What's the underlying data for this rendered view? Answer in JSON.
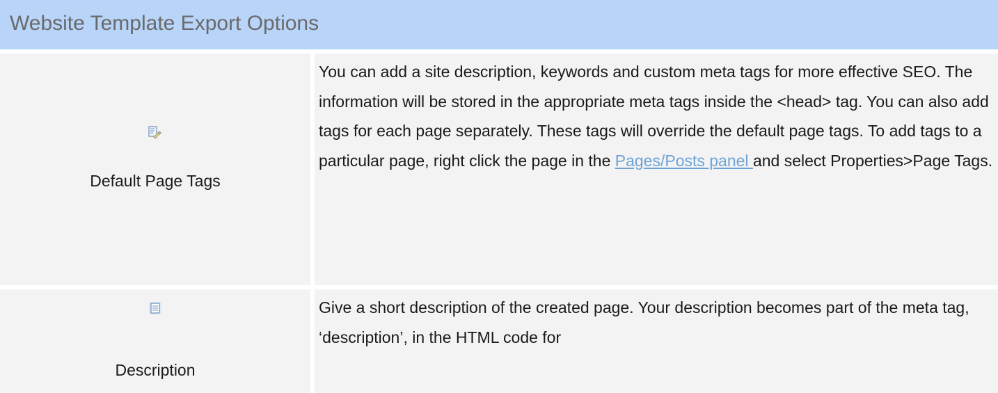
{
  "header": {
    "title": "Website Template Export Options"
  },
  "rows": [
    {
      "icon": "page-tags-icon",
      "label": "Default Page Tags",
      "text_before_link": "You can add a site description, keywords and custom meta tags for more effective SEO. The information will be stored in the appropriate meta tags inside the <head> tag. You can also add tags for each page separately. These tags will override the default page tags. To add tags to a particular page, right click the page in the ",
      "link": "Pages/Posts panel ",
      "text_after_link": " and select Properties>Page Tags."
    },
    {
      "icon": "description-icon",
      "label": "Description",
      "text": "Give a short description of the created page.  Your description becomes part of the meta tag, ‘description’, in the HTML code for"
    }
  ],
  "colors": {
    "header_bg": "#b8d4f8",
    "cell_bg": "#f3f3f3",
    "link": "#6ea3d6"
  }
}
